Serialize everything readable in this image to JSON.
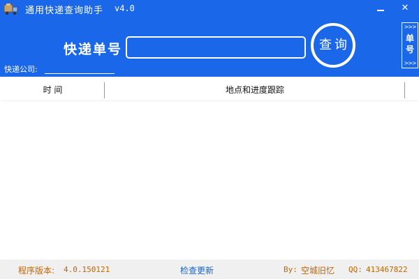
{
  "window": {
    "title": "通用快递查询助手",
    "version": "v4.0",
    "minimize_icon": "minimize-icon",
    "close_icon": "close-icon",
    "close_glyph": "✕"
  },
  "search": {
    "number_label": "快递单号",
    "number_value": "",
    "query_button": "查询",
    "company_label": "快递公司:",
    "company_value": ""
  },
  "side_tab": {
    "label": "单号",
    "arrows": ">>>",
    "icon": "double-chevron-right-icon"
  },
  "table": {
    "columns": [
      "时 间",
      "地点和进度跟踪"
    ],
    "rows": []
  },
  "footer": {
    "version_label": "程序版本:",
    "version_value": "4.0.150121",
    "check_update": "检查更新",
    "by_label": "By:",
    "author": "空城旧忆",
    "qq_label": "QQ:",
    "qq_value": "413467822"
  },
  "colors": {
    "header_blue": "#1a67ea",
    "footer_orange": "#c56400",
    "link_blue": "#1766c9"
  }
}
